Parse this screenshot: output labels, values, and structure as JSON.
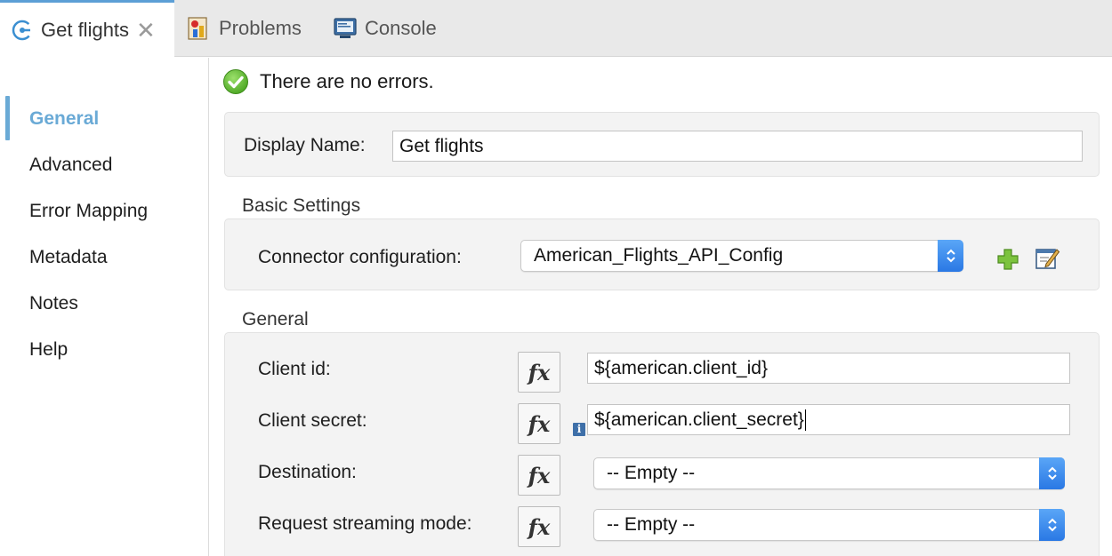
{
  "tabs": [
    {
      "label": "Get flights",
      "icon": "connector-icon",
      "close": "✕",
      "active": true
    },
    {
      "label": "Problems",
      "icon": "problems-icon"
    },
    {
      "label": "Console",
      "icon": "console-icon"
    }
  ],
  "sidebar": {
    "items": [
      {
        "label": "General",
        "active": true
      },
      {
        "label": "Advanced"
      },
      {
        "label": "Error Mapping"
      },
      {
        "label": "Metadata"
      },
      {
        "label": "Notes"
      },
      {
        "label": "Help"
      }
    ]
  },
  "status": {
    "text": "There are no errors.",
    "icon": "check-circle-icon"
  },
  "display_name": {
    "label": "Display Name:",
    "value": "Get flights"
  },
  "basic_settings": {
    "title": "Basic Settings",
    "connector_label": "Connector configuration:",
    "connector_value": "American_Flights_API_Config",
    "add_icon": "plus-icon",
    "edit_icon": "edit-icon"
  },
  "general": {
    "title": "General",
    "client_id": {
      "label": "Client id:",
      "value": "${american.client_id}"
    },
    "client_secret": {
      "label": "Client secret:",
      "value": "${american.client_secret}"
    },
    "destination": {
      "label": "Destination:",
      "value": "-- Empty --"
    },
    "request_streaming": {
      "label": "Request streaming mode:",
      "value": "-- Empty --"
    },
    "fx_label": "fx",
    "info_label": "i"
  },
  "colors": {
    "accent": "#6aaad6",
    "active_tab_border": "#5c9fd6",
    "select_stepper": "#2a78e4",
    "check_green": "#5db531"
  }
}
